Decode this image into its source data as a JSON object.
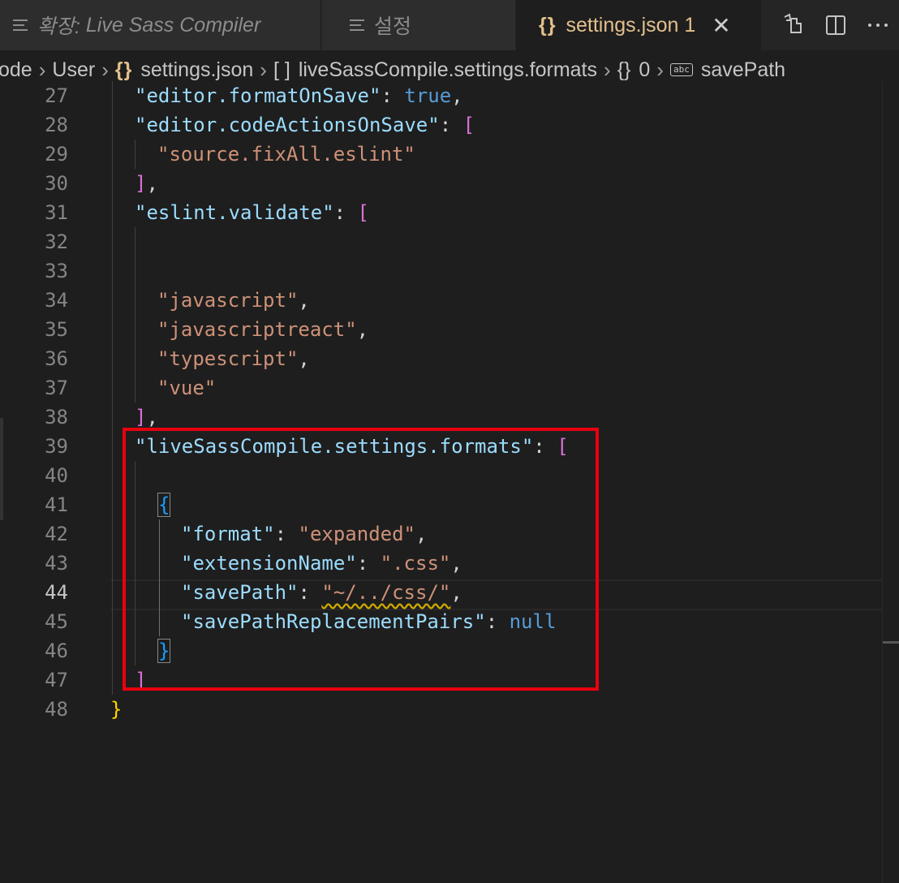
{
  "tabs": [
    {
      "prefix": "확장:",
      "label": "Live Sass Compiler"
    },
    {
      "label": "설정"
    },
    {
      "label": "settings.json",
      "badge": "1"
    }
  ],
  "tab_icons": [
    "preview-lines-icon",
    "settings-lines-icon",
    "json-braces-icon"
  ],
  "actions": [
    "open-changes-icon",
    "split-editor-icon",
    "more-actions-icon"
  ],
  "breadcrumb": {
    "items": [
      "ode",
      "User",
      "settings.json",
      "liveSassCompile.settings.formats",
      "0",
      "savePath"
    ],
    "icons": [
      "braces-icon",
      "array-icon",
      "object-icon",
      "string-property-icon"
    ]
  },
  "editor": {
    "active_line": "44",
    "lines": [
      {
        "n": "27"
      },
      {
        "n": "28"
      },
      {
        "n": "29"
      },
      {
        "n": "30"
      },
      {
        "n": "31"
      },
      {
        "n": "32"
      },
      {
        "n": "33"
      },
      {
        "n": "34"
      },
      {
        "n": "35"
      },
      {
        "n": "36"
      },
      {
        "n": "37"
      },
      {
        "n": "38"
      },
      {
        "n": "39"
      },
      {
        "n": "40"
      },
      {
        "n": "41"
      },
      {
        "n": "42"
      },
      {
        "n": "43"
      },
      {
        "n": "44"
      },
      {
        "n": "45"
      },
      {
        "n": "46"
      },
      {
        "n": "47"
      },
      {
        "n": "48"
      }
    ],
    "tokens": {
      "l27_key": "\"editor.formatOnSave\"",
      "l27_val": "true",
      "l28_key": "\"editor.codeActionsOnSave\"",
      "l28_open": "[",
      "l29_str": "\"source.fixAll.eslint\"",
      "l30_close": "]",
      "l31_key": "\"eslint.validate\"",
      "l31_open": "[",
      "l34_str": "\"javascript\"",
      "l35_str": "\"javascriptreact\"",
      "l36_str": "\"typescript\"",
      "l37_str": "\"vue\"",
      "l38_close": "]",
      "l39_key": "\"liveSassCompile.settings.formats\"",
      "l39_open": "[",
      "l41_open": "{",
      "l42_key": "\"format\"",
      "l42_val": "\"expanded\"",
      "l43_key": "\"extensionName\"",
      "l43_val": "\".css\"",
      "l44_key": "\"savePath\"",
      "l44_val": "\"~/../css/\"",
      "l45_key": "\"savePathReplacementPairs\"",
      "l45_val": "null",
      "l46_close": "}",
      "l47_close": "]",
      "l48_close": "}",
      "colon": ":",
      "comma": ","
    }
  },
  "colors": {
    "background": "#1e1e1e",
    "key": "#9cdcfe",
    "string": "#ce9178",
    "keyword": "#569cd6",
    "highlight_box": "#e8000f",
    "modified_tab": "#e2c08d"
  }
}
